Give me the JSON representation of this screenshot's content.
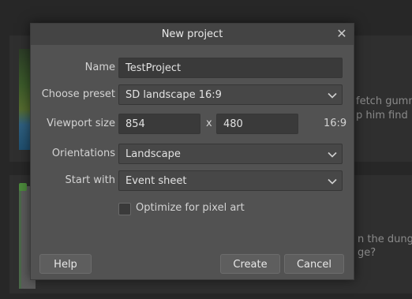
{
  "background": {
    "card1_text": [
      "fetch gumm",
      "p him find hi"
    ],
    "card2_text": [
      "n the dunge",
      "ge?"
    ]
  },
  "dialog": {
    "title": "New project",
    "fields": {
      "name_label": "Name",
      "name_value": "TestProject",
      "preset_label": "Choose preset",
      "preset_value": "SD landscape 16:9",
      "viewport_label": "Viewport size",
      "viewport_width": "854",
      "viewport_sep": "x",
      "viewport_height": "480",
      "viewport_ratio": "16:9",
      "orientation_label": "Orientations",
      "orientation_value": "Landscape",
      "start_label": "Start with",
      "start_value": "Event sheet",
      "pixel_art_label": "Optimize for pixel art",
      "pixel_art_checked": false
    },
    "buttons": {
      "help": "Help",
      "create": "Create",
      "cancel": "Cancel"
    }
  },
  "icons": {
    "close": "close-icon",
    "dropdown": "chevron-down-icon"
  }
}
